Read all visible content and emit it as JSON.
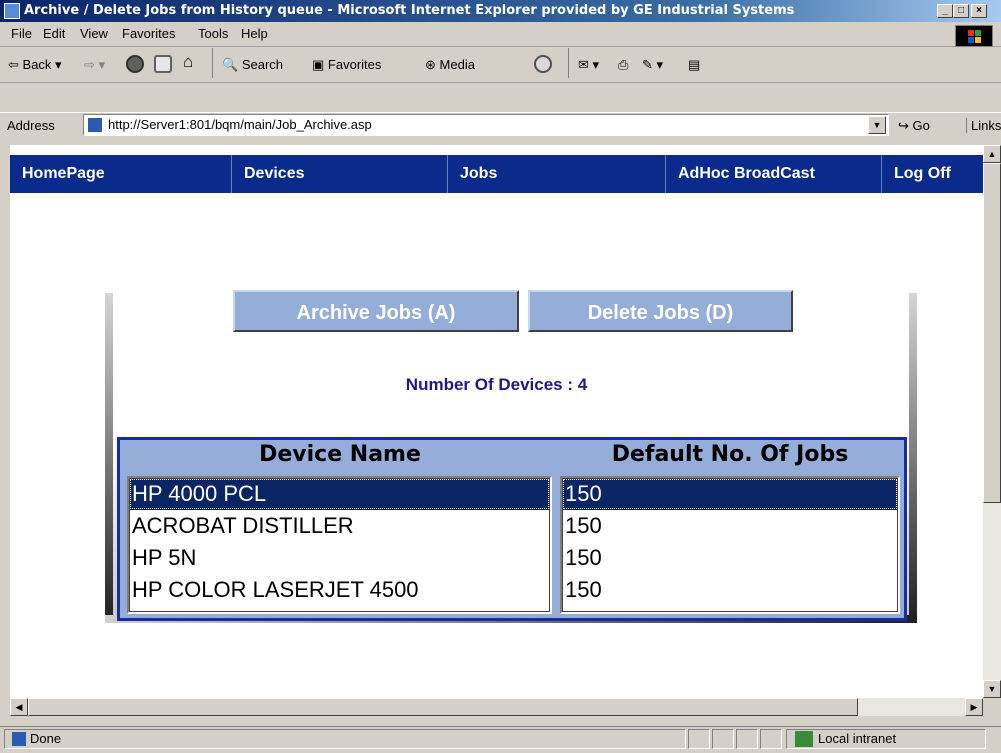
{
  "window": {
    "title": "Archive / Delete Jobs from History queue - Microsoft Internet Explorer provided by GE Industrial Systems",
    "buttons": [
      "_",
      "□",
      "×"
    ]
  },
  "menu": [
    "File",
    "Edit",
    "View",
    "Favorites",
    "Tools",
    "Help"
  ],
  "toolbar": {
    "back": "Back",
    "search": "Search",
    "favorites": "Favorites",
    "media": "Media"
  },
  "address": {
    "label": "Address",
    "url": "http://Server1:801/bqm/main/Job_Archive.asp",
    "go": "Go",
    "links": "Links"
  },
  "nav": [
    "HomePage",
    "Devices",
    "Jobs",
    "AdHoc BroadCast",
    "Log Off"
  ],
  "actions": {
    "archive": "Archive Jobs  (A)",
    "delete": "Delete Jobs  (D)"
  },
  "device_count_text": "Number Of Devices : 4",
  "table": {
    "headers": [
      "Device Name",
      "Default No. Of Jobs"
    ],
    "devices": [
      "HP 4000 PCL",
      "ACROBAT DISTILLER",
      "HP 5N",
      "HP COLOR LASERJET 4500"
    ],
    "jobs": [
      "150",
      "150",
      "150",
      "150"
    ],
    "selected_index": 0
  },
  "status": {
    "text": "Done",
    "zone": "Local intranet"
  },
  "colors": {
    "nav_bg": "#0a2a8c",
    "button_bg": "#95aed9",
    "selected_row": "#0a2466",
    "count_text": "#1a1a8c"
  }
}
